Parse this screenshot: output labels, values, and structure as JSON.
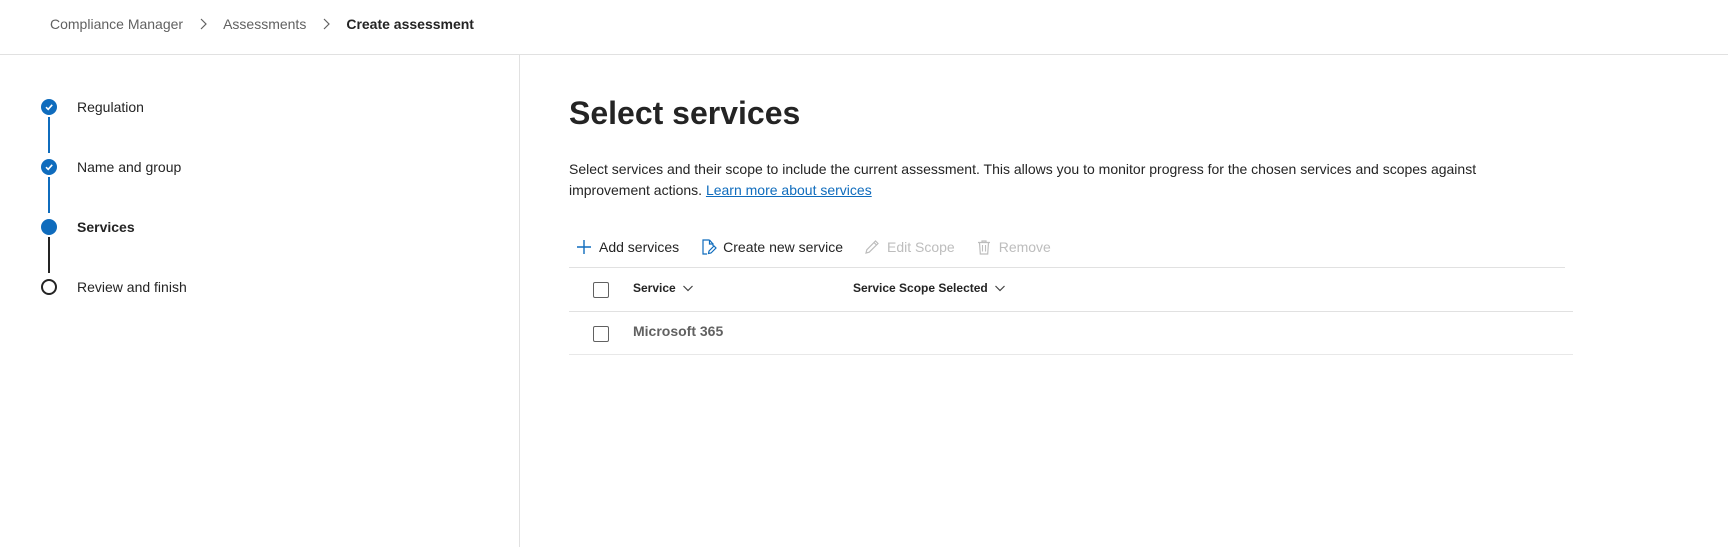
{
  "breadcrumb": {
    "items": [
      "Compliance Manager",
      "Assessments"
    ],
    "current": "Create assessment"
  },
  "wizard": {
    "steps": [
      {
        "label": "Regulation",
        "state": "done"
      },
      {
        "label": "Name and group",
        "state": "done"
      },
      {
        "label": "Services",
        "state": "current"
      },
      {
        "label": "Review and finish",
        "state": "todo"
      }
    ]
  },
  "main": {
    "title": "Select services",
    "description": "Select services and their scope to include the current assessment. This allows you to monitor progress for the chosen services and scopes against improvement actions.",
    "learn_more_link": "Learn more about services"
  },
  "toolbar": {
    "add_label": "Add services",
    "add_icon": "plus-icon",
    "create_label": "Create new service",
    "create_icon": "document-edit-icon",
    "edit_label": "Edit Scope",
    "edit_icon": "pencil-icon",
    "remove_label": "Remove",
    "remove_icon": "trash-icon"
  },
  "grid": {
    "columns": [
      "Service",
      "Service Scope Selected"
    ],
    "rows": [
      {
        "service": "Microsoft 365",
        "scope": ""
      }
    ]
  },
  "colors": {
    "accent": "#0f6cbd",
    "text": "#242424",
    "muted": "#616161",
    "disabled": "#bdbdbd",
    "divider": "#e1e1e1"
  }
}
